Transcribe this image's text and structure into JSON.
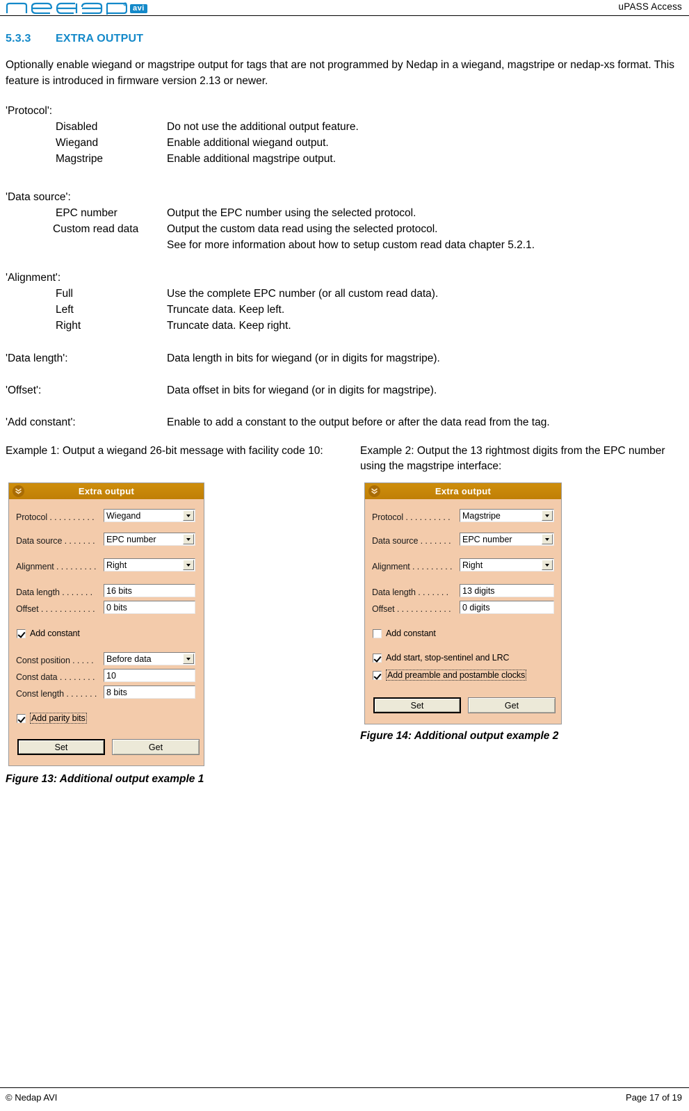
{
  "header": {
    "logo_word": "nedap",
    "logo_badge": "avi",
    "product_title": "uPASS Access"
  },
  "section": {
    "number": "5.3.3",
    "title": "EXTRA OUTPUT",
    "intro": "Optionally enable wiegand or magstripe output for tags that are not programmed by Nedap in a wiegand, magstripe or nedap-xs format. This feature is introduced in firmware version 2.13 or newer."
  },
  "blocks": {
    "protocol": {
      "title": "'Protocol':",
      "items": [
        {
          "term": "Disabled",
          "desc": "Do not use the additional output feature."
        },
        {
          "term": "Wiegand",
          "desc": "Enable additional wiegand output."
        },
        {
          "term": "Magstripe",
          "desc": "Enable additional magstripe output."
        }
      ]
    },
    "data_source": {
      "title": "'Data source':",
      "items": [
        {
          "term": "EPC number",
          "desc": "Output the EPC number using the selected protocol."
        },
        {
          "term": "Custom read data",
          "desc": "Output the custom data read using the selected protocol."
        },
        {
          "term": "",
          "desc": "See for more information about how to setup custom read data chapter 5.2.1."
        }
      ]
    },
    "alignment": {
      "title": "'Alignment':",
      "items": [
        {
          "term": "Full",
          "desc": "Use the complete EPC number (or all custom read data)."
        },
        {
          "term": "Left",
          "desc": "Truncate data. Keep left."
        },
        {
          "term": "Right",
          "desc": "Truncate data. Keep right."
        }
      ]
    },
    "data_length": {
      "key": "'Data length':",
      "value": "Data length in bits for wiegand (or in digits for magstripe)."
    },
    "offset": {
      "key": "'Offset':",
      "value": "Data offset in bits for wiegand (or in digits for magstripe)."
    },
    "add_constant": {
      "key": "'Add constant':",
      "value": "Enable to add a constant to the output before or after the data read from the tag."
    }
  },
  "examples": {
    "example1_caption": "Example 1: Output a wiegand 26-bit message with facility code 10:",
    "example2_caption": "Example 2: Output the 13 rightmost digits from the EPC number using the magstripe interface:",
    "figure13_caption": "Figure 13: Additional output example 1",
    "figure14_caption": "Figure 14: Additional output example 2"
  },
  "dialog1": {
    "title": "Extra output",
    "fields": {
      "protocol_label": "Protocol . . . . . . . . . .",
      "protocol_value": "Wiegand",
      "data_source_label": "Data source . . . . . . .",
      "data_source_value": "EPC number",
      "alignment_label": "Alignment . . . . . . . . .",
      "alignment_value": "Right",
      "data_length_label": "Data length . . . . . . .",
      "data_length_value": "16 bits",
      "offset_label": "Offset . . . . . . . . . . . .",
      "offset_value": "0 bits",
      "add_constant_label": "Add constant",
      "const_position_label": "Const position . . . . .",
      "const_position_value": "Before data",
      "const_data_label": "Const data . . . . . . . .",
      "const_data_value": "10",
      "const_length_label": "Const length . . . . . . .",
      "const_length_value": "8 bits",
      "add_parity_label": "Add parity bits"
    },
    "buttons": {
      "set": "Set",
      "get": "Get"
    }
  },
  "dialog2": {
    "title": "Extra output",
    "fields": {
      "protocol_label": "Protocol . . . . . . . . . .",
      "protocol_value": "Magstripe",
      "data_source_label": "Data source . . . . . . .",
      "data_source_value": "EPC number",
      "alignment_label": "Alignment . . . . . . . . .",
      "alignment_value": "Right",
      "data_length_label": "Data length . . . . . . .",
      "data_length_value": "13 digits",
      "offset_label": "Offset . . . . . . . . . . . .",
      "offset_value": "0 digits",
      "add_constant_label": "Add constant",
      "add_sentinel_label": "Add start, stop-sentinel and LRC",
      "add_preamble_label": "Add preamble and postamble clocks"
    },
    "buttons": {
      "set": "Set",
      "get": "Get"
    }
  },
  "footer": {
    "copyright": "© Nedap AVI",
    "page": "Page 17 of 19"
  },
  "colors": {
    "brand_blue": "#1489C9",
    "dialog_header": "#C8880B",
    "dialog_body": "#F3CBAB",
    "button_face": "#ECE9D8"
  }
}
